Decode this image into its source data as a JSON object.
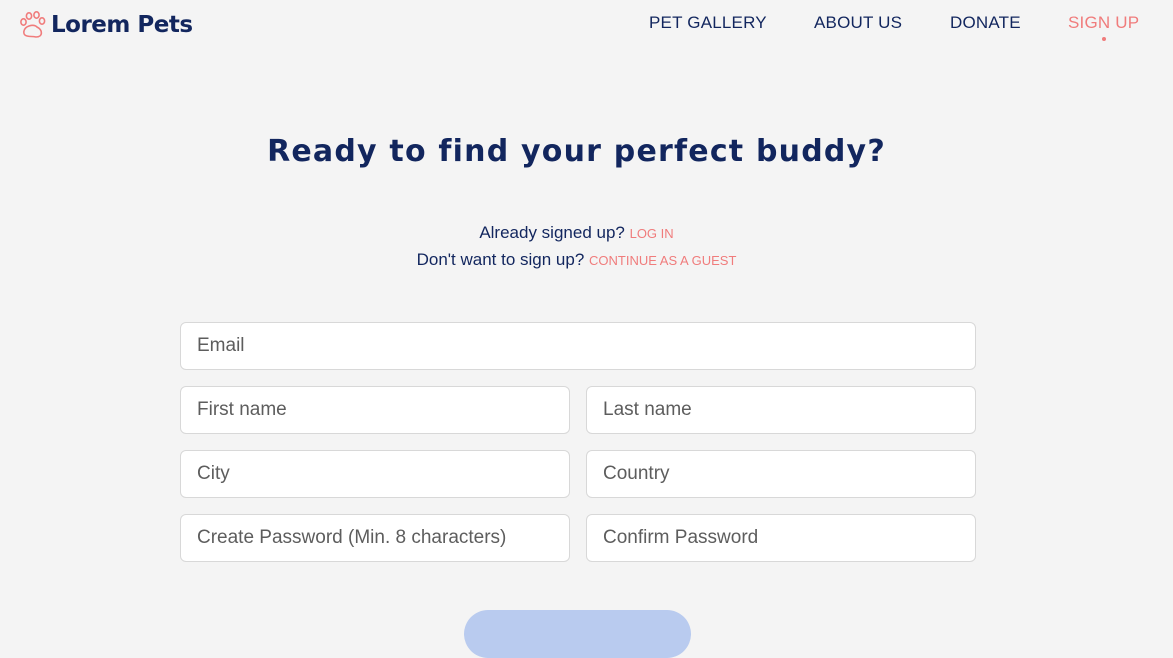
{
  "brand": {
    "name": "Lorem Pets",
    "logo_icon": "paw-icon",
    "accent_color": "#f07c7c",
    "text_color": "#12265e"
  },
  "nav": {
    "pet_gallery": "PET GALLERY",
    "about_us": "ABOUT US",
    "donate": "DONATE",
    "sign_up": "SIGN UP"
  },
  "page": {
    "title": "Ready to find your perfect buddy?",
    "already_signed_up": "Already signed up?",
    "log_in": "LOG IN",
    "dont_want_to_sign_up": "Don't want to sign up?",
    "continue_as_guest": "CONTINUE AS A GUEST"
  },
  "form": {
    "email": {
      "placeholder": "Email",
      "value": ""
    },
    "first_name": {
      "placeholder": "First name",
      "value": ""
    },
    "last_name": {
      "placeholder": "Last name",
      "value": ""
    },
    "city": {
      "placeholder": "City",
      "value": ""
    },
    "country": {
      "placeholder": "Country",
      "value": ""
    },
    "create_password": {
      "placeholder": "Create Password (Min. 8 characters)",
      "value": ""
    },
    "confirm_password": {
      "placeholder": "Confirm Password",
      "value": ""
    },
    "submit_color": "#b9cbef"
  }
}
